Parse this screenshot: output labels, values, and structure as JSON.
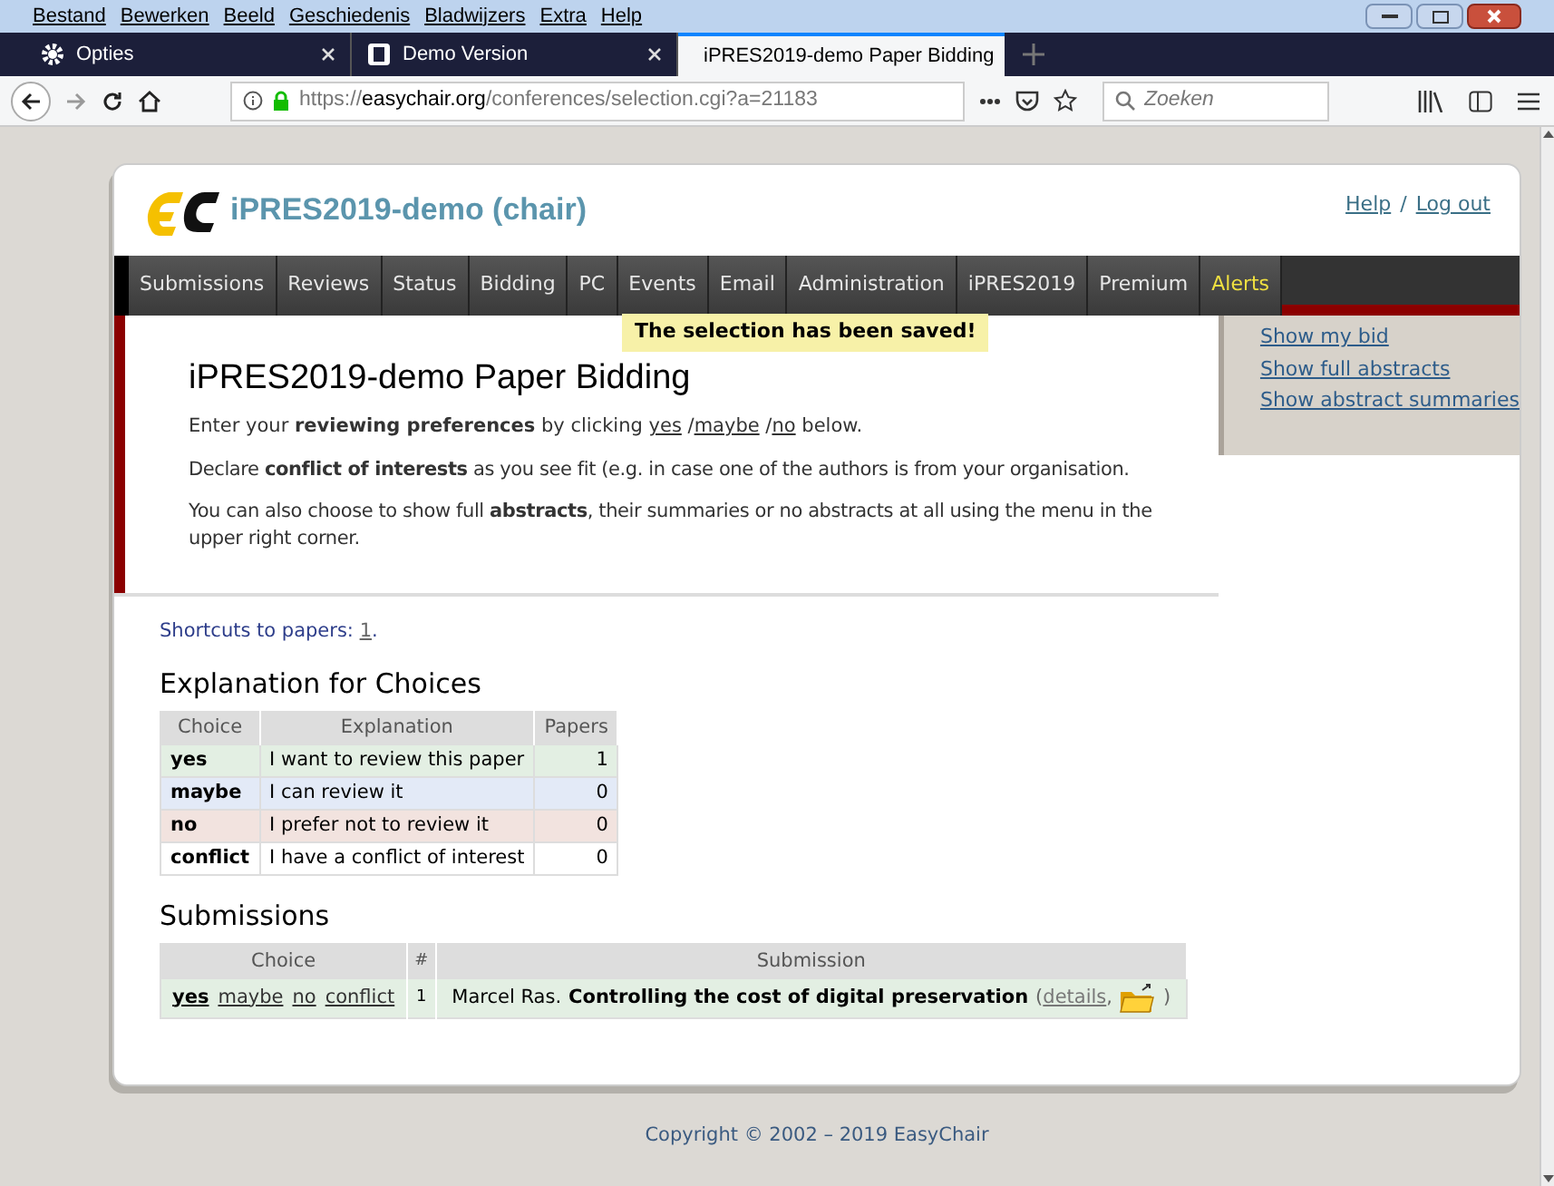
{
  "browser": {
    "menu": [
      "Bestand",
      "Bewerken",
      "Beeld",
      "Geschiedenis",
      "Bladwijzers",
      "Extra",
      "Help"
    ],
    "tabs": [
      {
        "label": "Opties",
        "kind": "settings",
        "selected": false
      },
      {
        "label": "Demo Version",
        "kind": "page",
        "selected": false
      },
      {
        "label": "iPRES2019-demo Paper Bidding",
        "kind": "chair",
        "selected": true
      }
    ],
    "url": {
      "scheme": "https://",
      "domain": "easychair.org",
      "path": "/conferences/selection.cgi?a=21183"
    },
    "search": {
      "placeholder": "Zoeken"
    }
  },
  "page": {
    "title": "iPRES2019-demo (chair)",
    "header_links": [
      "Help",
      "Log out"
    ],
    "header_separator": "/",
    "nav": [
      {
        "label": "Submissions",
        "kind": "normal"
      },
      {
        "label": "Reviews",
        "kind": "normal"
      },
      {
        "label": "Status",
        "kind": "normal"
      },
      {
        "label": "Bidding",
        "kind": "normal"
      },
      {
        "label": "PC",
        "kind": "normal"
      },
      {
        "label": "Events",
        "kind": "normal"
      },
      {
        "label": "Email",
        "kind": "normal"
      },
      {
        "label": "Administration",
        "kind": "normal"
      },
      {
        "label": "iPRES2019",
        "kind": "normal"
      },
      {
        "label": "Premium",
        "kind": "normal"
      },
      {
        "label": "Alerts",
        "kind": "alert"
      }
    ],
    "notice": "The selection has been saved!",
    "heading": "iPRES2019-demo Paper Bidding",
    "intro": {
      "before": "Enter your **reviewing preferences** by clicking",
      "links": [
        "yes",
        "maybe",
        "no"
      ],
      "link_separator": "/",
      "after": "below."
    },
    "paragraphs": [
      "Declare **conflict of interests** as you see fit (e.g. in case one of the authors is from your organisation.",
      "You can also choose to show full **abstracts**, their summaries or no abstracts at all using the menu in the upper right corner."
    ],
    "sidebar_links": [
      "Show my bid",
      "Show full abstracts",
      "Show abstract summaries"
    ],
    "shortcuts": {
      "label": "Shortcuts to papers:",
      "links": [
        "1"
      ],
      "end": "."
    },
    "explanation": {
      "heading": "Explanation for Choices",
      "columns": [
        "Choice",
        "Explanation",
        "Papers"
      ],
      "rows": [
        {
          "choice": "yes",
          "explanation": "I want to review this paper",
          "papers": "1",
          "color": "#e3efe3"
        },
        {
          "choice": "maybe",
          "explanation": "I can review it",
          "papers": "0",
          "color": "#e3eaf7"
        },
        {
          "choice": "no",
          "explanation": "I prefer not to review it",
          "papers": "0",
          "color": "#f2e3df"
        },
        {
          "choice": "conflict",
          "explanation": "I have a conflict of interest",
          "papers": "0",
          "color": "#ffffff"
        }
      ]
    },
    "submissions": {
      "heading": "Submissions",
      "columns": [
        "Choice",
        "#",
        "Submission"
      ],
      "rows": [
        {
          "choices": [
            {
              "label": "yes",
              "selected": true
            },
            {
              "label": "maybe",
              "selected": false
            },
            {
              "label": "no",
              "selected": false
            },
            {
              "label": "conflict",
              "selected": false
            }
          ],
          "number": "1",
          "authors": "Marcel Ras.",
          "title": "Controlling the cost of digital preservation",
          "open": "(",
          "details": "details",
          "separator": ",",
          "close": ")"
        }
      ]
    },
    "footer": "Copyright © 2002 – 2019 EasyChair"
  }
}
